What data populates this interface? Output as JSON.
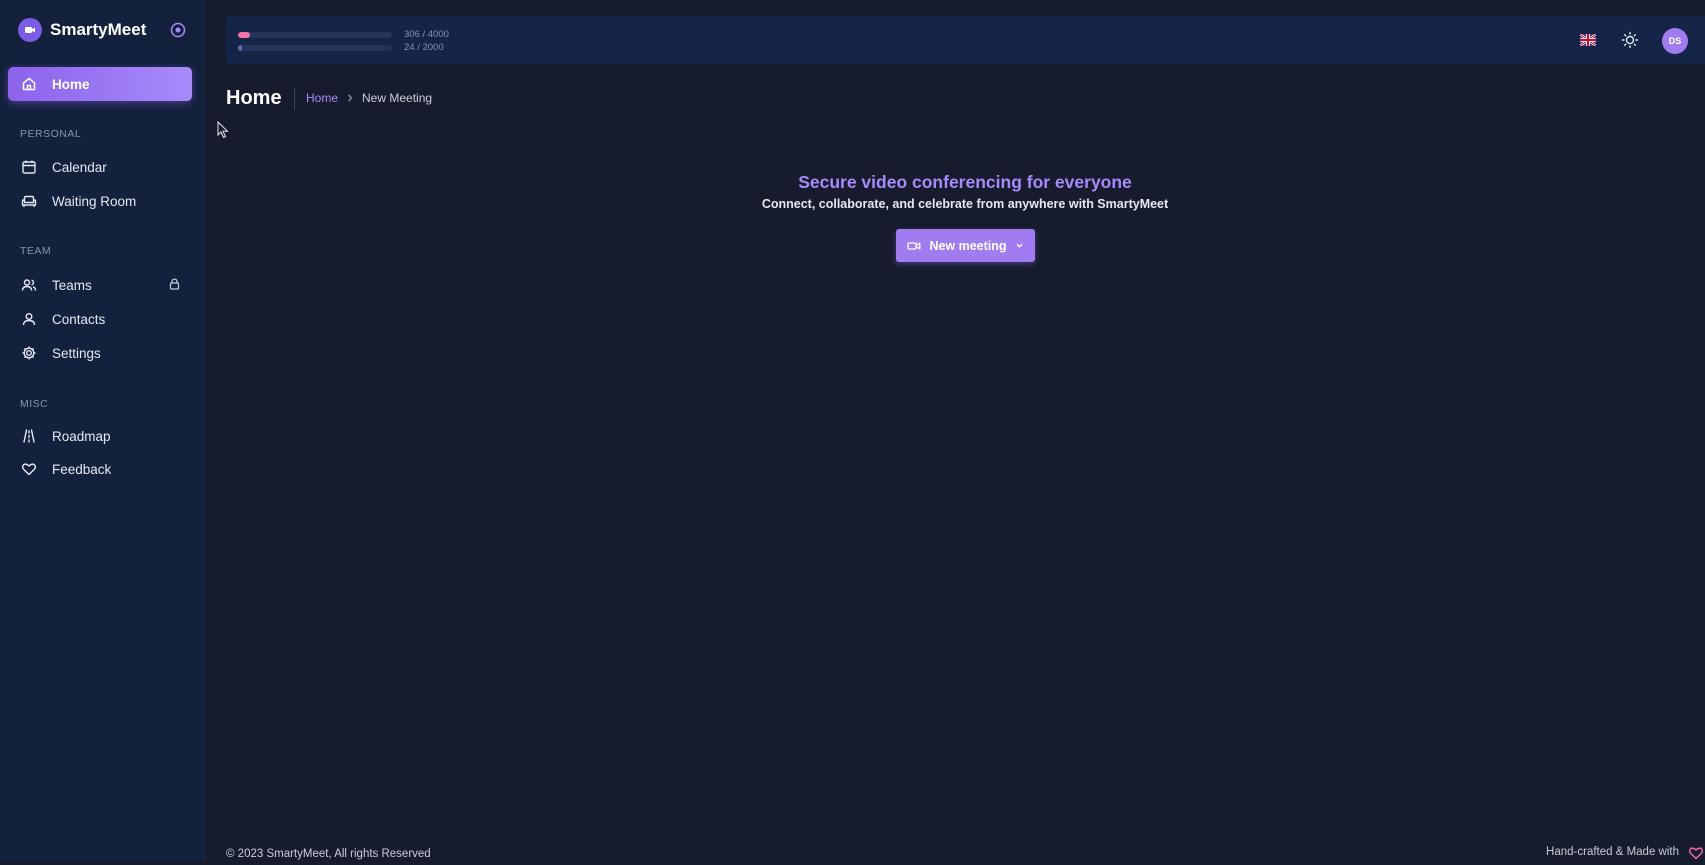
{
  "app": {
    "name": "SmartyMeet"
  },
  "sidebar": {
    "items": [
      {
        "label": "Home",
        "icon": "home-icon",
        "active": true
      },
      {
        "label": "Calendar",
        "icon": "calendar-icon"
      },
      {
        "label": "Waiting Room",
        "icon": "sofa-icon"
      },
      {
        "label": "Teams",
        "icon": "users-icon",
        "locked": true
      },
      {
        "label": "Contacts",
        "icon": "user-icon"
      },
      {
        "label": "Settings",
        "icon": "gear-icon"
      },
      {
        "label": "Roadmap",
        "icon": "road-icon"
      },
      {
        "label": "Feedback",
        "icon": "heart-icon"
      }
    ],
    "sections": {
      "personal": "PERSONAL",
      "team": "TEAM",
      "misc": "MISC"
    }
  },
  "topbar": {
    "usage": [
      {
        "text": "306 / 4000",
        "fraction": 0.0765,
        "color": "#f472a6"
      },
      {
        "text": "24 / 2000",
        "fraction": 0.012,
        "color": "#a78bfa"
      }
    ],
    "avatar": "DS",
    "language": "en-GB"
  },
  "page": {
    "title": "Home",
    "breadcrumb": {
      "home": "Home",
      "current": "New Meeting"
    }
  },
  "hero": {
    "title": "Secure video conferencing for everyone",
    "subtitle": "Connect, collaborate, and celebrate from anywhere with SmartyMeet",
    "button": "New meeting"
  },
  "footer": {
    "copyright": "© 2023 SmartyMeet, All rights Reserved",
    "credit": "Hand-crafted & Made with"
  },
  "colors": {
    "accent": "#a78bfa",
    "sidebar": "#13213d",
    "background": "#161b2e"
  }
}
